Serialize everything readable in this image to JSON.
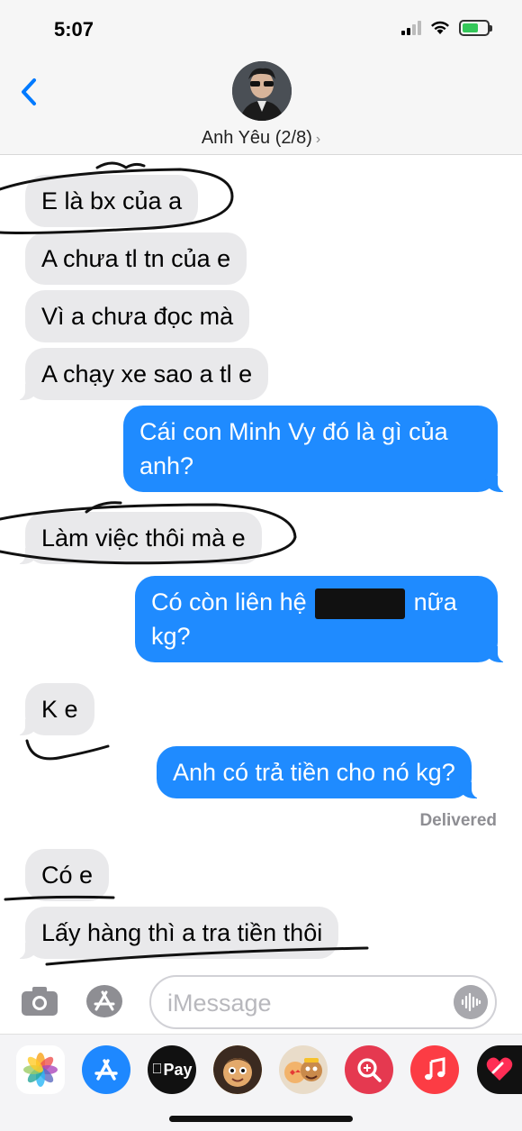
{
  "status_bar": {
    "time": "5:07"
  },
  "header": {
    "contact_name": "Anh Yêu (2/8)",
    "chevron": "›",
    "back_icon": "chevron-left-icon"
  },
  "messages": [
    {
      "from": "them",
      "text": "E là bx của a"
    },
    {
      "from": "them",
      "text": "A chưa tl tn của e"
    },
    {
      "from": "them",
      "text": "Vì a chưa đọc mà"
    },
    {
      "from": "them",
      "text": "A chạy xe sao a tl e"
    },
    {
      "from": "me",
      "line1": "Cái con Minh Vy đó là gì của",
      "line2": "anh?"
    },
    {
      "from": "them",
      "text": "Làm việc thôi mà e"
    },
    {
      "from": "me",
      "line1_before": "Có còn liên hệ",
      "line1_after": "nữa",
      "line2": "kg?"
    },
    {
      "from": "them",
      "text": "K e"
    },
    {
      "from": "me",
      "text": "Anh có trả tiền cho nó kg?"
    },
    {
      "from": "them",
      "text": "Có e"
    },
    {
      "from": "them",
      "text": "Lấy hàng thì a tra tiền thôi"
    }
  ],
  "delivered_label": "Delivered",
  "input": {
    "placeholder": "iMessage",
    "value": ""
  },
  "app_drawer": {
    "apps": [
      "photos-icon",
      "app-store-icon",
      "apple-pay-icon",
      "memoji-icon",
      "memoji-stickers-icon",
      "image-search-icon",
      "music-icon",
      "digital-touch-icon"
    ],
    "apple_pay_label": "Pay"
  },
  "colors": {
    "incoming_bubble": "#e9e9eb",
    "outgoing_bubble": "#1f8bff",
    "accent": "#007aff"
  }
}
